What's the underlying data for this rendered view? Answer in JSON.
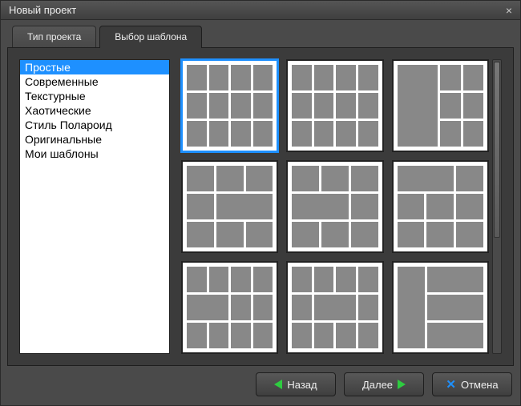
{
  "window": {
    "title": "Новый проект"
  },
  "tabs": {
    "project_type": "Тип проекта",
    "template_select": "Выбор шаблона",
    "active_index": 1
  },
  "sidebar": {
    "items": [
      "Простые",
      "Современные",
      "Текстурные",
      "Хаотические",
      "Стиль Полароид",
      "Оригинальные",
      "Мои шаблоны"
    ],
    "selected_index": 0
  },
  "gallery": {
    "selected_index": 0,
    "count": 9
  },
  "buttons": {
    "back": "Назад",
    "next": "Далее",
    "cancel": "Отмена"
  },
  "icons": {
    "close": "×"
  }
}
